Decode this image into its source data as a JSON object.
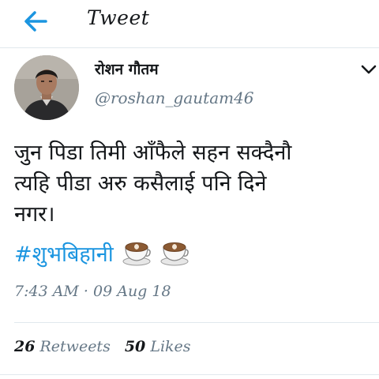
{
  "header": {
    "title": "Tweet"
  },
  "user": {
    "name": "रोशन गौतम",
    "handle": "@roshan_gautam46"
  },
  "tweet": {
    "line1": "जुन पिडा तिमी आँफैले सहन सक्दैनौ",
    "line2": "त्यहि पीडा अरु कसैलाई पनि दिने",
    "line3": "नगर।",
    "hashtag": "#शुभबिहानी",
    "emoji": [
      "coffee-icon",
      "coffee-icon"
    ]
  },
  "meta": {
    "timestamp": "7:43 AM · 09 Aug 18"
  },
  "stats": {
    "retweets_count": "26",
    "retweets_label": "Retweets",
    "likes_count": "50",
    "likes_label": "Likes"
  },
  "colors": {
    "accent": "#1b95e0",
    "muted": "#657786",
    "text": "#14171a",
    "divider": "#e1e8ed"
  }
}
